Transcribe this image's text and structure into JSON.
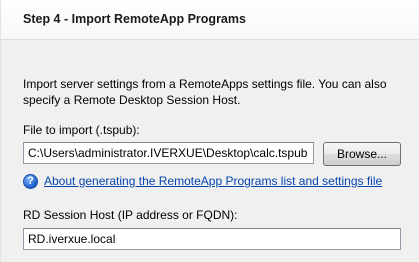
{
  "step_title": "Step 4 - Import RemoteApp Programs",
  "description": "Import server settings from a RemoteApps settings file. You can also specify a Remote Desktop Session Host.",
  "file_import": {
    "label": "File to import (.tspub):",
    "value": "C:\\Users\\administrator.IVERXUE\\Desktop\\calc.tspub",
    "browse_label": "Browse..."
  },
  "help_link": {
    "icon": "question-mark-icon",
    "text": "About generating the RemoteApp Programs list and settings file"
  },
  "rd_host": {
    "label": "RD Session Host (IP address or FQDN):",
    "value": "RD.iverxue.local"
  }
}
